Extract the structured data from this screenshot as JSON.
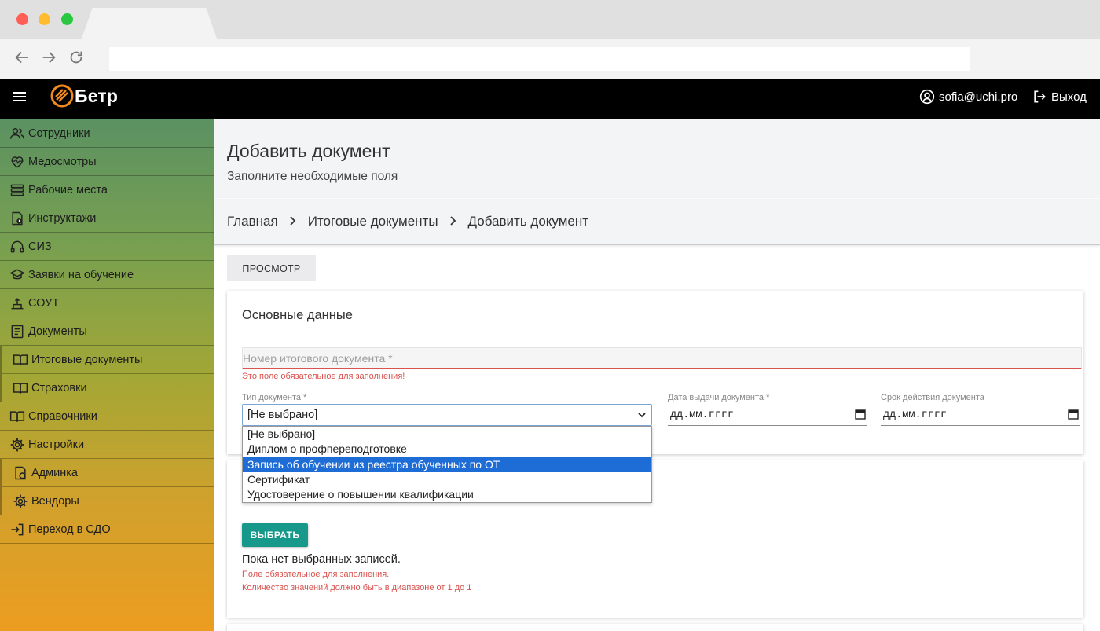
{
  "header": {
    "logo_text": "Бетр",
    "user_email": "sofia@uchi.pro",
    "logout_label": "Выход"
  },
  "sidebar": {
    "items": [
      {
        "label": "Сотрудники",
        "icon": "users-icon"
      },
      {
        "label": "Медосмотры",
        "icon": "heart-icon"
      },
      {
        "label": "Рабочие места",
        "icon": "stack-icon"
      },
      {
        "label": "Инструктажи",
        "icon": "file-info-icon"
      },
      {
        "label": "СИЗ",
        "icon": "headphones-icon"
      },
      {
        "label": "Заявки на обучение",
        "icon": "graduation-cap-icon"
      },
      {
        "label": "СОУТ",
        "icon": "hazard-icon"
      },
      {
        "label": "Документы",
        "icon": "document-icon"
      },
      {
        "label": "Итоговые документы",
        "icon": "book-icon"
      },
      {
        "label": "Страховки",
        "icon": "book-icon"
      },
      {
        "label": "Справочники",
        "icon": "book-icon"
      },
      {
        "label": "Настройки",
        "icon": "gear-icon"
      },
      {
        "label": "Админка",
        "icon": "admin-icon"
      },
      {
        "label": "Вендоры",
        "icon": "gear-icon"
      },
      {
        "label": "Переход в СДО",
        "icon": "login-icon"
      }
    ]
  },
  "page": {
    "title": "Добавить документ",
    "subtitle": "Заполните необходимые поля"
  },
  "breadcrumb": {
    "items": [
      "Главная",
      "Итоговые документы",
      "Добавить документ"
    ]
  },
  "toolbar": {
    "preview_label": "ПРОСМОТР"
  },
  "form": {
    "section_title": "Основные данные",
    "doc_number_placeholder": "Номер итогового документа *",
    "doc_number_error": "Это поле обязательное для заполнения!",
    "doc_type_label": "Тип документа *",
    "doc_type_value": "[Не выбрано]",
    "issue_date_label": "Дата выдачи документа *",
    "issue_date_value": "дд.мм.гггг",
    "validity_label": "Срок действия документа",
    "validity_value": "дд.мм.гггг"
  },
  "dropdown": {
    "options": [
      "[Не выбрано]",
      "Диплом о профпереподготовке",
      "Запись об обучении из реестра обученных по ОТ",
      "Сертификат",
      "Удостоверение о повышении квалификации"
    ],
    "highlighted": "Запись об обучении из реестра обученных по ОТ"
  },
  "selection": {
    "choose_label": "ВЫБРАТЬ",
    "empty_text": "Пока нет выбранных записей.",
    "error_required": "Поле обязательное для заполнения.",
    "error_range": "Количество значений должно быть в диапазоне от 1 до 1"
  },
  "colors": {
    "accent_teal": "#16998a",
    "error_red": "#d9534f",
    "select_highlight": "#1e6cd6",
    "logo_orange": "#f08a1c"
  }
}
